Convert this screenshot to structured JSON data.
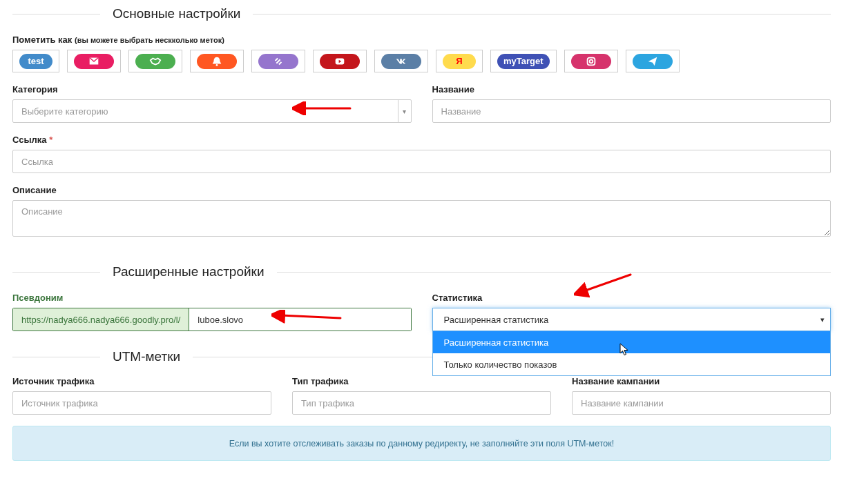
{
  "basic_section": {
    "title": "Основные настройки"
  },
  "tags_label": {
    "text": "Пометить как",
    "hint": "(вы можете выбрать нескколько меток)"
  },
  "tags": [
    {
      "kind": "text",
      "label": "test",
      "color": "#428bca"
    },
    {
      "kind": "mail",
      "color": "#e91e63"
    },
    {
      "kind": "handshake",
      "color": "#4caf50"
    },
    {
      "kind": "bell",
      "color": "#ff5722"
    },
    {
      "kind": "link",
      "color": "#9575cd"
    },
    {
      "kind": "play",
      "color": "#c4161c"
    },
    {
      "kind": "vk",
      "color": "#5b7fa6"
    },
    {
      "kind": "yandex",
      "label": "Я",
      "color": "#ffdb4d"
    },
    {
      "kind": "text",
      "label": "myTarget",
      "color": "#3f51b5"
    },
    {
      "kind": "camera",
      "color": "#d6336c"
    },
    {
      "kind": "plane",
      "color": "#2ca5e0"
    }
  ],
  "category": {
    "label": "Категория",
    "placeholder": "Выберите категорию",
    "caret": "▾"
  },
  "name": {
    "label": "Название",
    "placeholder": "Название"
  },
  "link": {
    "label": "Ссылка",
    "required_mark": "*",
    "placeholder": "Ссылка"
  },
  "description": {
    "label": "Описание",
    "placeholder": "Описание"
  },
  "advanced_section": {
    "title": "Расширенные настройки"
  },
  "alias": {
    "label": "Псевдоним",
    "prefix": "https://nadya666.nadya666.goodly.pro/l/",
    "value": "luboe.slovo"
  },
  "statistics": {
    "label": "Статистика",
    "value": "Расширенная статистика",
    "caret": "▾",
    "open": true,
    "options": [
      {
        "label": "Расширенная статистика",
        "selected": true
      },
      {
        "label": "Только количество показов",
        "selected": false
      }
    ]
  },
  "utm_section": {
    "title": "UTM-метки"
  },
  "utm_fields": [
    {
      "label": "Источник трафика",
      "placeholder": "Источник трафика"
    },
    {
      "label": "Тип трафика",
      "placeholder": "Тип трафика"
    },
    {
      "label": "Название кампании",
      "placeholder": "Название кампании"
    }
  ],
  "notice": {
    "text": "Если вы хотите отслеживать заказы по данному редиректу, не заполняйте эти поля UTM-меток!"
  }
}
